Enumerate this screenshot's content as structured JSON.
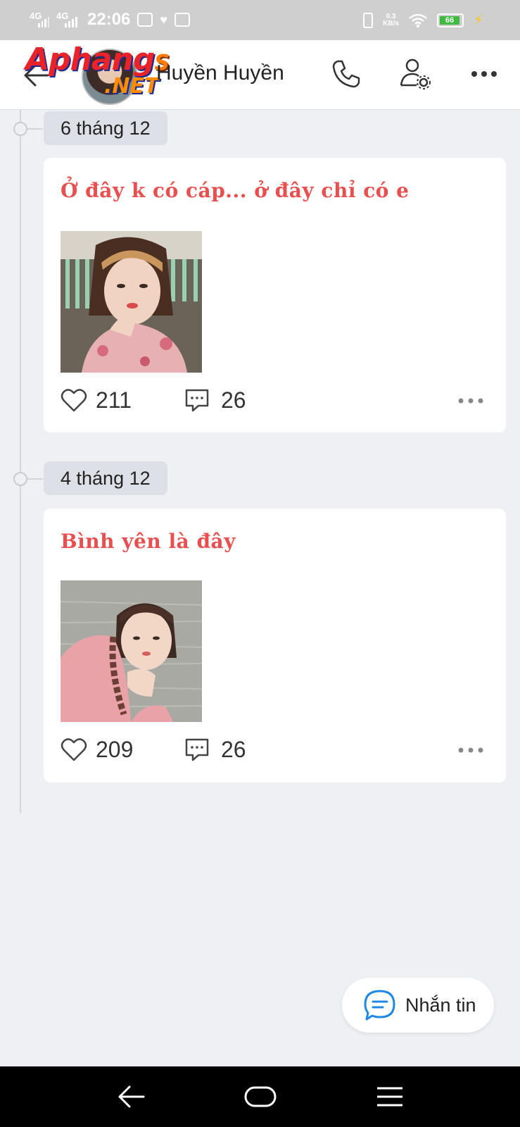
{
  "status_bar": {
    "net1": "4G",
    "net2": "4G",
    "time": "22:06",
    "speed_value": "0.3",
    "speed_unit": "KB/s",
    "battery": "66"
  },
  "header": {
    "logo_main": "Aphang",
    "logo_s": "S",
    "logo_net": ".NET",
    "profile_name": "Huyền Huyền",
    "icons": [
      "back-arrow-icon",
      "phone-icon",
      "user-settings-icon",
      "more-icon"
    ]
  },
  "posts": [
    {
      "date": "6 tháng 12",
      "text": "Ở đây k có cáp... ở đây chỉ có e",
      "likes": "211",
      "comments": "26"
    },
    {
      "date": "4 tháng 12",
      "text": "Bình yên là đây",
      "likes": "209",
      "comments": "26"
    }
  ],
  "message_button": {
    "label": "Nhắn tin"
  },
  "colors": {
    "post_text": "#e8504f",
    "background": "#eef0f4",
    "accent_blue": "#1e88e5"
  }
}
